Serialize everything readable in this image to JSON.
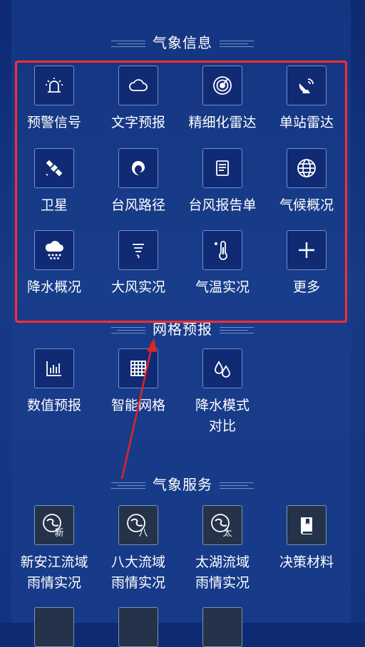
{
  "sections": {
    "weather_info": {
      "title": "气象信息",
      "items": [
        {
          "label": "预警信号",
          "icon": "alarm-light-icon"
        },
        {
          "label": "文字预报",
          "icon": "cloud-icon"
        },
        {
          "label": "精细化雷达",
          "icon": "radar-icon"
        },
        {
          "label": "单站雷达",
          "icon": "satellite-dish-icon"
        },
        {
          "label": "卫星",
          "icon": "satellite-icon"
        },
        {
          "label": "台风路径",
          "icon": "typhoon-icon"
        },
        {
          "label": "台风报告单",
          "icon": "report-icon"
        },
        {
          "label": "气候概况",
          "icon": "globe-icon"
        },
        {
          "label": "降水概况",
          "icon": "rain-cloud-icon"
        },
        {
          "label": "大风实况",
          "icon": "tornado-icon"
        },
        {
          "label": "气温实况",
          "icon": "thermometer-icon"
        },
        {
          "label": "更多",
          "icon": "plus-icon"
        }
      ]
    },
    "grid_forecast": {
      "title": "网格预报",
      "items": [
        {
          "label": "数值预报",
          "icon": "bar-chart-icon"
        },
        {
          "label": "智能网格",
          "icon": "grid-icon"
        },
        {
          "label": "降水模式\n对比",
          "icon": "water-drops-icon"
        }
      ]
    },
    "weather_service": {
      "title": "气象服务",
      "items": [
        {
          "label": "新安江流域\n雨情实况",
          "icon": "river-basin-icon",
          "badge": "新"
        },
        {
          "label": "八大流域\n雨情实况",
          "icon": "river-basin-icon",
          "badge": "八"
        },
        {
          "label": "太湖流域\n雨情实况",
          "icon": "river-basin-icon",
          "badge": "太"
        },
        {
          "label": "决策材料",
          "icon": "book-icon"
        }
      ]
    }
  },
  "colors": {
    "background": "#0d2a72",
    "tile_border": "#6f8fd0",
    "highlight_box": "#ff2d2d",
    "arrow": "#e02424"
  }
}
